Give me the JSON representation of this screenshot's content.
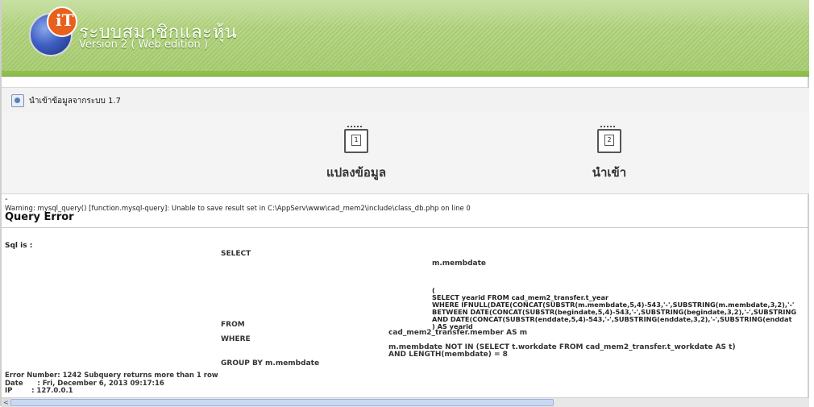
{
  "header": {
    "title": "ระบบสมาชิกและหุ้น",
    "subtitle": "Version 2 ( Web edition )",
    "logo_letters": "iT"
  },
  "menu": {
    "item_label": "นำเข้าข้อมูลจากระบบ 1.7",
    "icon": "document-icon"
  },
  "tools": [
    {
      "number": "1",
      "label": "แปลงข้อมูล",
      "icon": "calendar-icon"
    },
    {
      "number": "2",
      "label": "นำเข้า",
      "icon": "calendar-icon"
    }
  ],
  "error": {
    "dash": "-",
    "warning": "Warning: mysql_query() [function.mysql-query]: Unable to save result set in C:\\AppServ\\www\\cad_mem2\\include\\class_db.php on line 0",
    "title": "Query Error",
    "sql_label": "Sql is :",
    "select_kw": "SELECT",
    "select_field": "m.membdate",
    "sub_open": "(",
    "sub_line1": "SELECT yearid FROM cad_mem2_transfer.t_year",
    "sub_line2": "WHERE IFNULL(DATE(CONCAT(SUBSTR(m.membdate,5,4)-543,'-',SUBSTRING(m.membdate,3,2),'-'",
    "sub_line3": "BETWEEN DATE(CONCAT(SUBSTR(begindate,5,4)-543,'-',SUBSTRING(begindate,3,2),'-',SUBSTRING",
    "sub_line4": "AND DATE(CONCAT(SUBSTR(enddate,5,4)-543,'-',SUBSTRING(enddate,3,2),'-',SUBSTRING(enddat",
    "sub_close": ") AS yearid",
    "from_kw": "FROM",
    "from_value": "cad_mem2_transfer.member AS m",
    "where_kw": "WHERE",
    "where_line1": "m.membdate NOT IN (SELECT t.workdate FROM cad_mem2_transfer.t_workdate AS t)",
    "where_line2": "AND LENGTH(membdate) = 8",
    "group_kw": "GROUP BY m.membdate",
    "footer": "Error Number: 1242 Subquery returns more than 1 row\nDate      : Fri, December 6, 2013 09:17:16\nIP        : 127.0.0.1"
  },
  "scrollbar": {
    "left_arrow": "<",
    "position_fraction": 0.0,
    "visible_fraction": 0.67
  }
}
